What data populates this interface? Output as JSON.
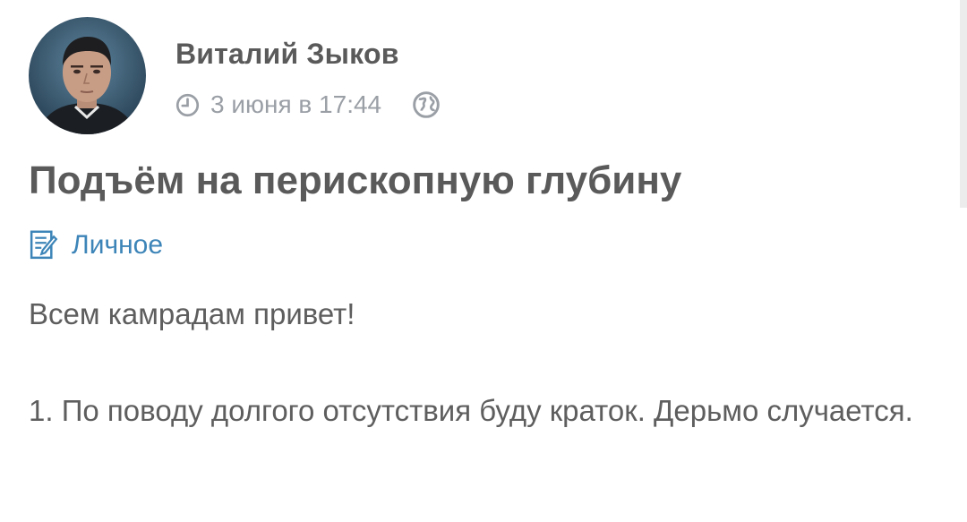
{
  "post": {
    "author_name": "Виталий Зыков",
    "timestamp": "3 июня в 17:44",
    "title": "Подъём на перископную глубину",
    "category": "Личное",
    "paragraphs": [
      "Всем камрадам привет!",
      "1. По поводу долгого отсутствия буду краток. Дерьмо случается."
    ]
  },
  "icons": {
    "timestamp_icon": "clock-icon",
    "visibility_icon": "globe-icon",
    "category_icon": "document-edit-icon"
  },
  "colors": {
    "author_text": "#5a5a5a",
    "meta_text": "#9a9fa6",
    "category_link": "#3d85b8",
    "body_text": "#5e5e5e",
    "background": "#ffffff"
  }
}
